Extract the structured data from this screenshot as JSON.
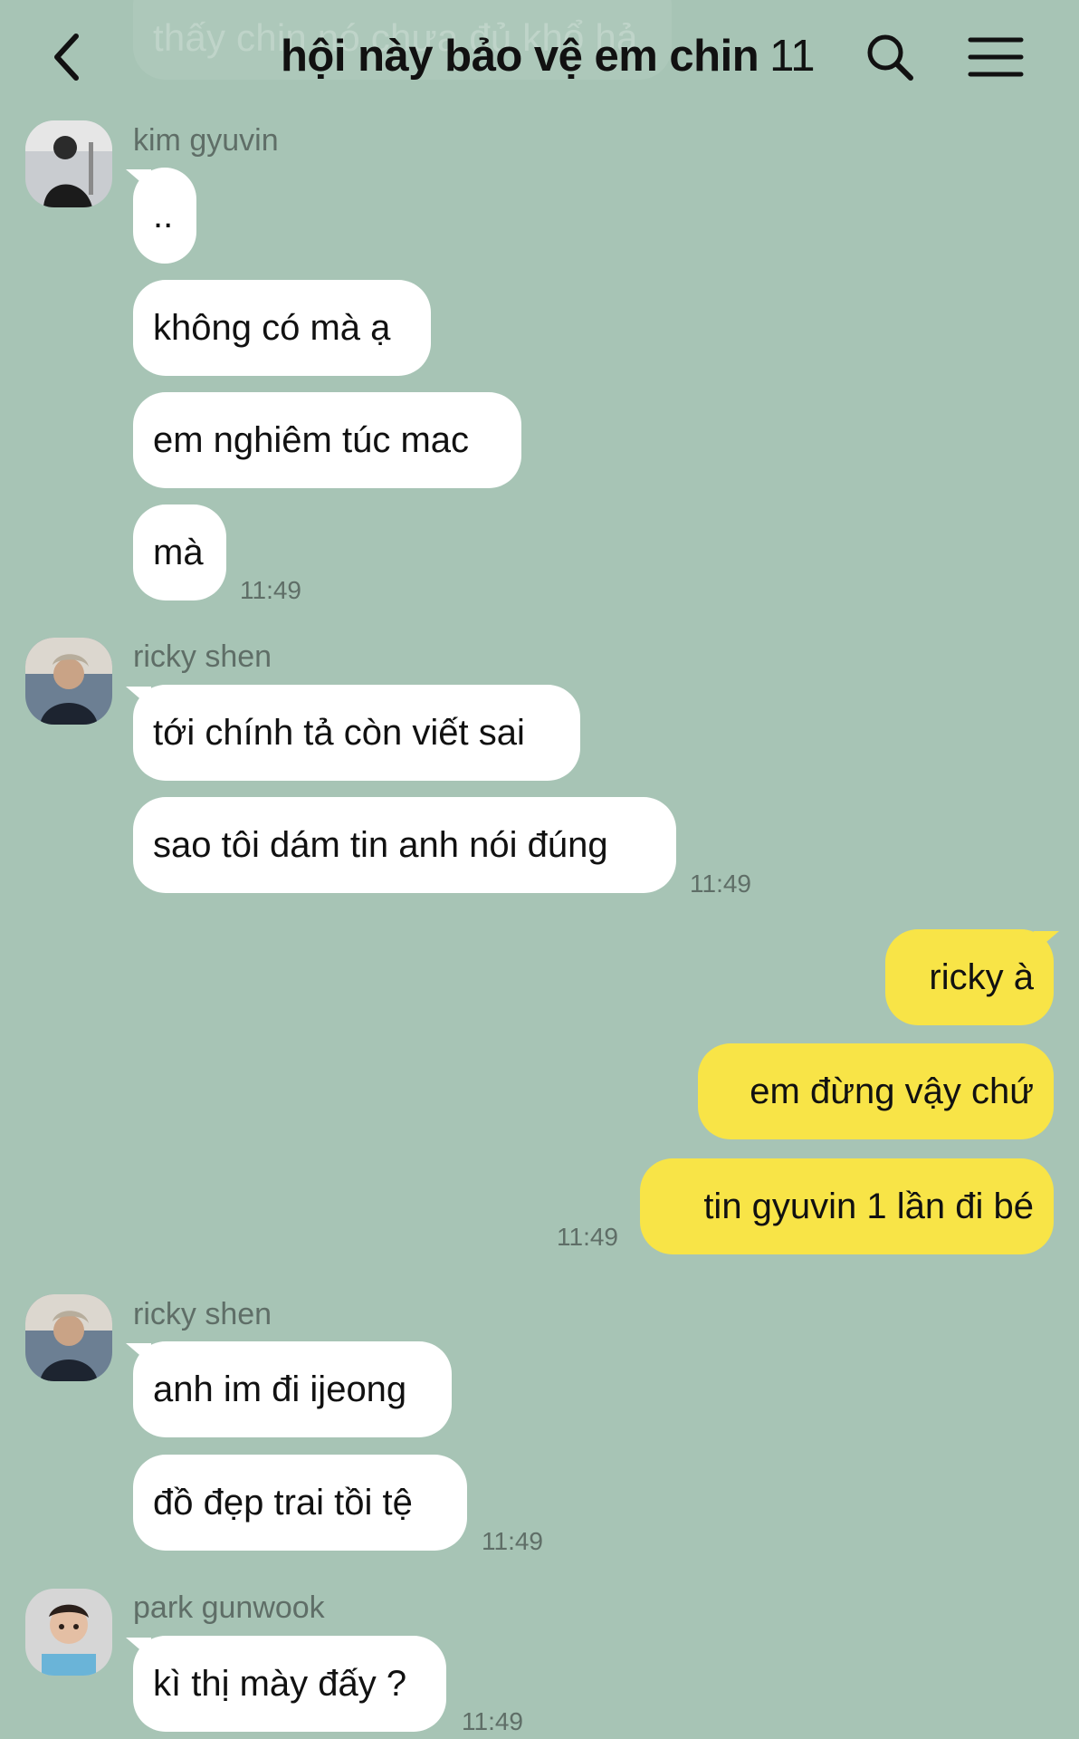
{
  "header": {
    "title": "hội này bảo vệ em chin",
    "member_count": "11",
    "ghost_message": "thấy chin nó chưa đủ khổ hả"
  },
  "icons": {
    "back": "back-icon",
    "search": "search-icon",
    "menu": "menu-icon"
  },
  "messages": [
    {
      "sender": "kim gyuvin",
      "items": [
        {
          "text": ".."
        },
        {
          "text": "không có mà ạ"
        },
        {
          "text": "em nghiêm túc mac"
        },
        {
          "text": "mà"
        }
      ],
      "time": "11:49"
    },
    {
      "sender": "ricky shen",
      "items": [
        {
          "text": "tới chính tả còn viết sai"
        },
        {
          "text": "sao tôi dám tin anh nói đúng"
        }
      ],
      "time": "11:49"
    },
    {
      "sender": "me",
      "items": [
        {
          "text": "ricky à"
        },
        {
          "text": "em đừng vậy chứ"
        },
        {
          "text": "tin gyuvin 1 lần đi bé"
        }
      ],
      "time": "11:49"
    },
    {
      "sender": "ricky shen",
      "items": [
        {
          "text": "anh im đi ijeong"
        },
        {
          "text": "đồ đẹp trai tồi tệ"
        }
      ],
      "time": "11:49"
    },
    {
      "sender": "park gunwook",
      "items": [
        {
          "text": "kì thị mày đấy ?"
        }
      ],
      "time": "11:49"
    }
  ],
  "colors": {
    "background": "#a7c4b5",
    "incoming_bubble": "#ffffff",
    "outgoing_bubble": "#f8e447",
    "secondary_text": "#5f6e67"
  }
}
